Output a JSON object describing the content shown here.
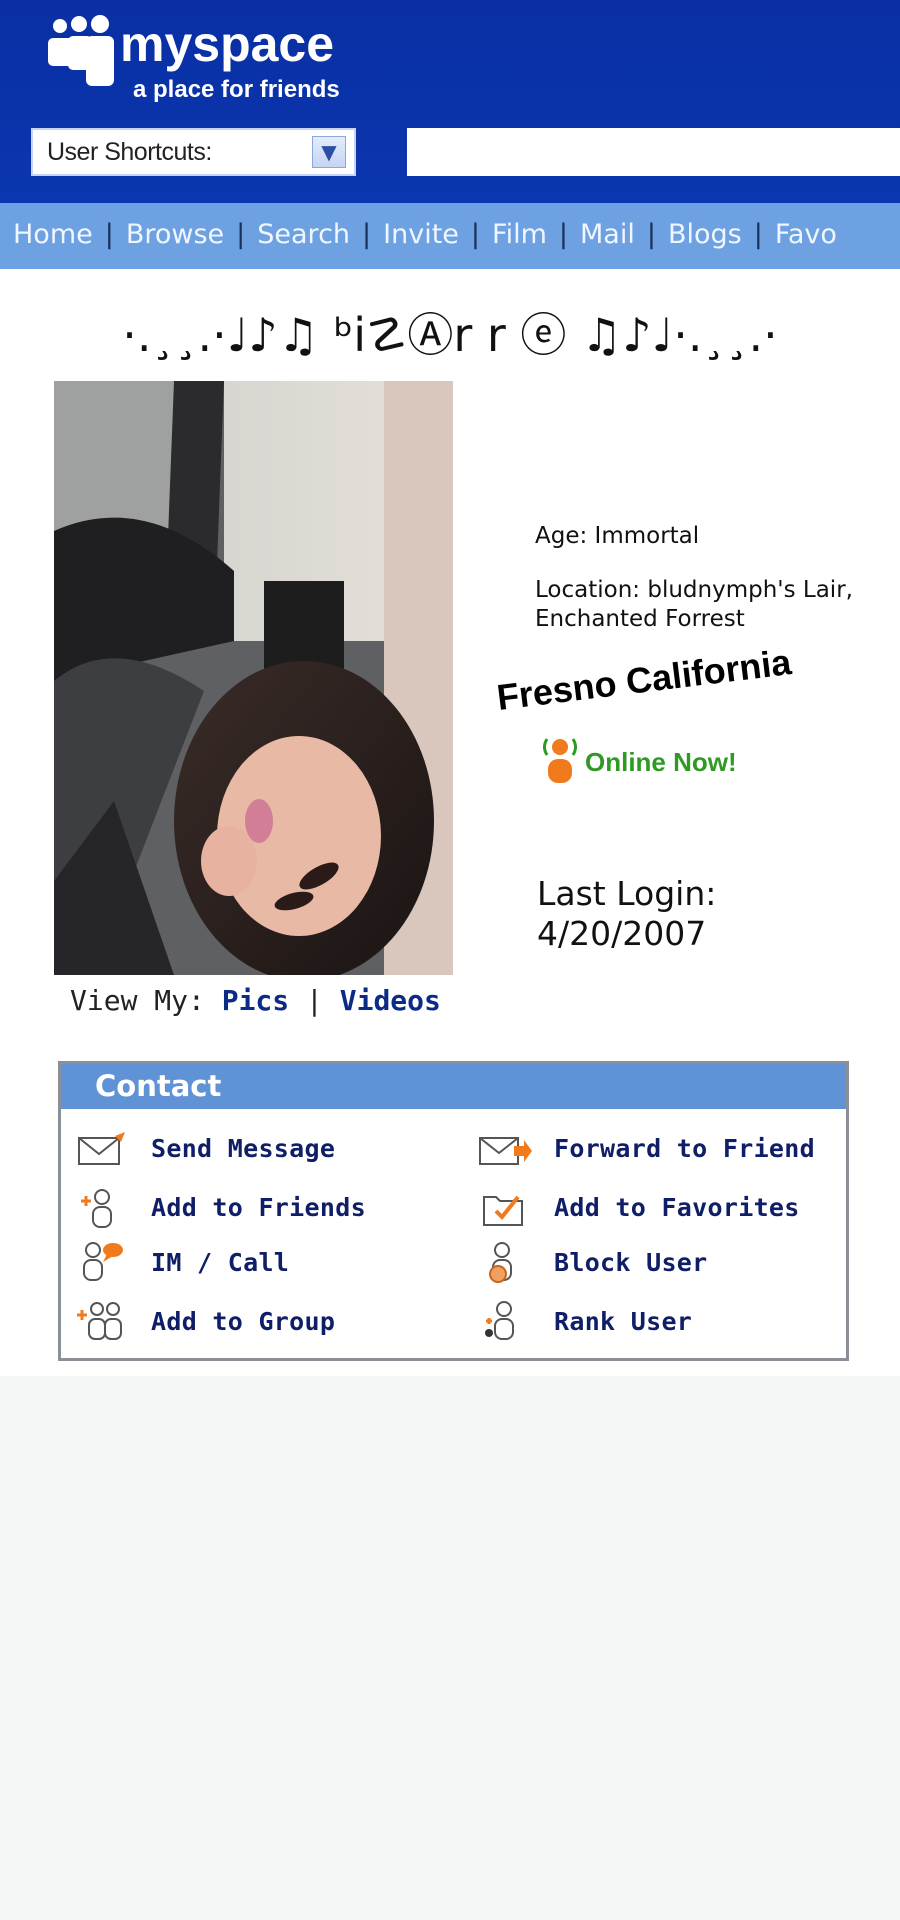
{
  "header": {
    "logo_name": "myspace",
    "logo_tagline": "a place for friends",
    "shortcuts_label": "User Shortcuts:",
    "search_value": ""
  },
  "nav": {
    "items": [
      "Home",
      "Browse",
      "Search",
      "Invite",
      "Film",
      "Mail",
      "Blogs",
      "Favo"
    ]
  },
  "profile": {
    "display_name": "·.¸¸.·♩♪♫ ᵇi☡Ⓐr r ⓔ ♫♪♩·.¸¸.·",
    "view_my_label": "View My:",
    "view_pics": "Pics",
    "view_separator": "|",
    "view_videos": "Videos",
    "age": "Age: Immortal",
    "location": "Location: bludnymph's Lair, Enchanted Forrest",
    "sticker_text": "Fresno California",
    "online_status": "Online Now!",
    "last_login_label": "Last Login:",
    "last_login_date": "4/20/2007"
  },
  "contact": {
    "title": "Contact",
    "actions": [
      {
        "label": "Send Message",
        "icon": "envelope-icon"
      },
      {
        "label": "Forward to Friend",
        "icon": "forward-envelope-icon"
      },
      {
        "label": "Add to Friends",
        "icon": "add-friend-icon"
      },
      {
        "label": "Add to Favorites",
        "icon": "favorites-folder-icon"
      },
      {
        "label": "IM / Call",
        "icon": "im-call-icon"
      },
      {
        "label": "Block User",
        "icon": "block-user-icon"
      },
      {
        "label": "Add to Group",
        "icon": "add-group-icon"
      },
      {
        "label": "Rank User",
        "icon": "rank-user-icon"
      }
    ]
  },
  "colors": {
    "header_blue": "#0b34ab",
    "nav_blue": "#6da1e2",
    "contact_header": "#5f93d6",
    "link_navy": "#0f1e66",
    "online_green": "#2e9a22",
    "online_orange": "#f07a1c"
  }
}
